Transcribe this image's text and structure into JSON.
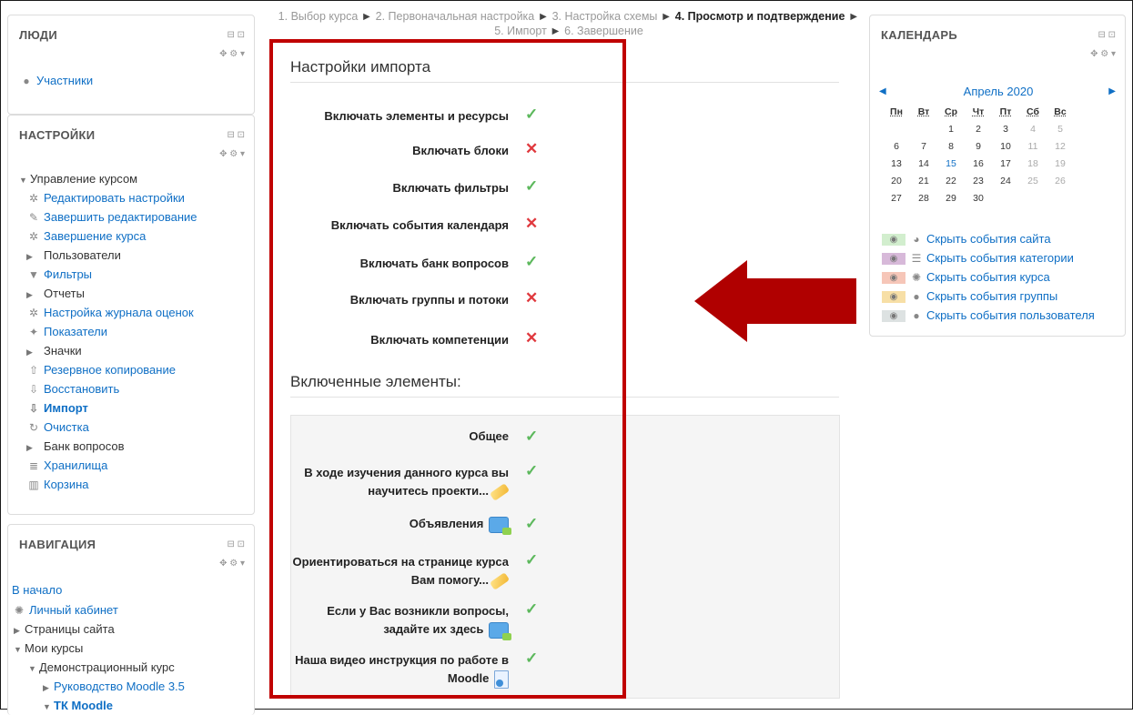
{
  "breadcrumb": {
    "step1": "1. Выбор курса",
    "step2": "2. Первоначальная настройка",
    "step3": "3. Настройка схемы",
    "step4": "4. Просмотр и подтверждение",
    "step5": "5. Импорт",
    "step6": "6. Завершение",
    "separator": "►"
  },
  "people": {
    "title": "ЛЮДИ",
    "participants": "Участники"
  },
  "settings": {
    "title": "НАСТРОЙКИ",
    "items": [
      {
        "label": "Управление курсом",
        "icon": "triangle-down"
      },
      {
        "label": "Редактировать настройки",
        "icon": "gear-icon"
      },
      {
        "label": "Завершить редактирование",
        "icon": "pencil-icon"
      },
      {
        "label": "Завершение курса",
        "icon": "gear-icon"
      },
      {
        "label": "Пользователи",
        "icon": "triangle-right"
      },
      {
        "label": "Фильтры",
        "icon": "filter-icon"
      },
      {
        "label": "Отчеты",
        "icon": "triangle-right"
      },
      {
        "label": "Настройка журнала оценок",
        "icon": "gear-icon"
      },
      {
        "label": "Показатели",
        "icon": "magic-icon"
      },
      {
        "label": "Значки",
        "icon": "triangle-right"
      },
      {
        "label": "Резервное копирование",
        "icon": "upload-icon"
      },
      {
        "label": "Восстановить",
        "icon": "download-icon"
      },
      {
        "label": "Импорт",
        "icon": "download-icon"
      },
      {
        "label": "Очистка",
        "icon": "refresh-icon"
      },
      {
        "label": "Банк вопросов",
        "icon": "triangle-right"
      },
      {
        "label": "Хранилища",
        "icon": "database-icon"
      },
      {
        "label": "Корзина",
        "icon": "trash-icon"
      }
    ]
  },
  "navigation": {
    "title": "НАВИГАЦИЯ",
    "home": "В начало",
    "dashboard": "Личный кабинет",
    "site_pages": "Страницы сайта",
    "my_courses": "Мои курсы",
    "demo_course": "Демонстрационный курс",
    "moodle_guide": "Руководство Moodle 3.5",
    "tk_moodle": "ТК Moodle"
  },
  "import_settings": {
    "heading": "Настройки импорта",
    "rows": [
      {
        "label": "Включать элементы и ресурсы",
        "enabled": true
      },
      {
        "label": "Включать блоки",
        "enabled": false
      },
      {
        "label": "Включать фильтры",
        "enabled": true
      },
      {
        "label": "Включать события календаря",
        "enabled": false
      },
      {
        "label": "Включать банк вопросов",
        "enabled": true
      },
      {
        "label": "Включать группы и потоки",
        "enabled": false
      },
      {
        "label": "Включать компетенции",
        "enabled": false
      }
    ]
  },
  "included": {
    "heading": "Включенные элементы:",
    "rows": [
      {
        "line1": "Общее",
        "line2": "",
        "icon": ""
      },
      {
        "line1": "В ходе изучения данного курса вы",
        "line2": "научитесь проекти...",
        "icon": "label-icon"
      },
      {
        "line1": "Объявления",
        "line2": "",
        "icon": "forum-icon"
      },
      {
        "line1": "Ориентироваться на странице курса",
        "line2": "Вам помогу...",
        "icon": "label-icon"
      },
      {
        "line1": "Если у Вас возникли вопросы,",
        "line2": "задайте их здесь",
        "icon": "forum-icon"
      },
      {
        "line1": "Наша видео инструкция по работе в",
        "line2": "Moodle",
        "icon": "file-icon"
      }
    ]
  },
  "calendar": {
    "title": "КАЛЕНДАРЬ",
    "month": "Апрель 2020",
    "weekdays": [
      "Пн",
      "Вт",
      "Ср",
      "Чт",
      "Пт",
      "Сб",
      "Вс"
    ],
    "weeks": [
      [
        "",
        "",
        "1",
        "2",
        "3",
        "4",
        "5"
      ],
      [
        "6",
        "7",
        "8",
        "9",
        "10",
        "11",
        "12"
      ],
      [
        "13",
        "14",
        "15",
        "16",
        "17",
        "18",
        "19"
      ],
      [
        "20",
        "21",
        "22",
        "23",
        "24",
        "25",
        "26"
      ],
      [
        "27",
        "28",
        "29",
        "30",
        "",
        "",
        ""
      ]
    ],
    "today": "15",
    "events": [
      {
        "label": "Скрыть события сайта",
        "color": "#d2eece"
      },
      {
        "label": "Скрыть события категории",
        "color": "#d7b9d9"
      },
      {
        "label": "Скрыть события курса",
        "color": "#f6c6b8"
      },
      {
        "label": "Скрыть события группы",
        "color": "#f7dfa6"
      },
      {
        "label": "Скрыть события пользователя",
        "color": "#dde2e2"
      }
    ]
  },
  "colors": {
    "highlight": "#c00000",
    "ok": "#5cb85c",
    "no": "#e0393e",
    "link": "#0f6fc5"
  }
}
